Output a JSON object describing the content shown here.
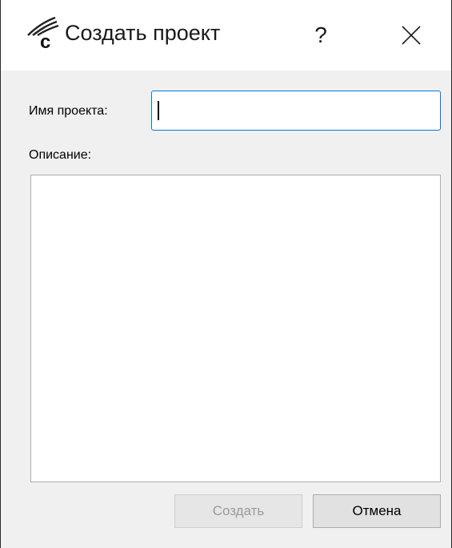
{
  "window": {
    "title": "Создать проект",
    "help_label": "?",
    "app_icon": "app-logo-icon",
    "close_icon": "close-icon"
  },
  "form": {
    "name_label": "Имя проекта:",
    "name_value": "",
    "description_label": "Описание:",
    "description_value": ""
  },
  "buttons": {
    "create_label": "Создать",
    "create_enabled": false,
    "cancel_label": "Отмена"
  },
  "colors": {
    "focus_border": "#0078d7",
    "disabled_text": "#9a9a9a"
  }
}
